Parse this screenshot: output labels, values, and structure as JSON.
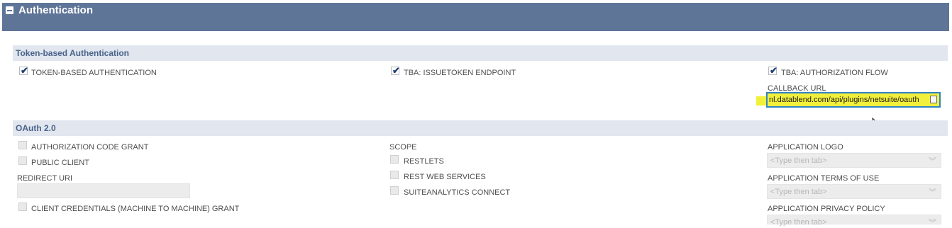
{
  "header": {
    "title": "Authentication"
  },
  "tba_section": {
    "title": "Token-based Authentication",
    "token_based_authentication": {
      "label": "TOKEN-BASED AUTHENTICATION",
      "checked": true
    },
    "issuetoken_endpoint": {
      "label": "TBA: ISSUETOKEN ENDPOINT",
      "checked": true
    },
    "authorization_flow": {
      "label": "TBA: AUTHORIZATION FLOW",
      "checked": true
    },
    "callback_url": {
      "label": "CALLBACK URL",
      "value": "nl.datablend.com/api/plugins/netsuite/oauth"
    }
  },
  "oauth_section": {
    "title": "OAuth 2.0",
    "authorization_code_grant": {
      "label": "AUTHORIZATION CODE GRANT",
      "checked": false
    },
    "public_client": {
      "label": "PUBLIC CLIENT",
      "checked": false
    },
    "redirect_uri": {
      "label": "REDIRECT URI",
      "value": ""
    },
    "client_credentials_grant": {
      "label": "CLIENT CREDENTIALS (MACHINE TO MACHINE) GRANT",
      "checked": false
    },
    "scope": {
      "label": "SCOPE",
      "restlets": "RESTLETS",
      "rest_web_services": "REST WEB SERVICES",
      "suiteanalytics_connect": "SUITEANALYTICS CONNECT"
    },
    "application_logo": {
      "label": "APPLICATION LOGO",
      "placeholder": "<Type then tab>"
    },
    "application_terms_of_use": {
      "label": "APPLICATION TERMS OF USE",
      "placeholder": "<Type then tab>"
    },
    "application_privacy_policy": {
      "label": "APPLICATION PRIVACY POLICY",
      "placeholder": "<Type then tab>"
    }
  },
  "colors": {
    "header_bg": "#5f7598",
    "section_bg": "#e1e6ef",
    "section_title": "#4a6389",
    "highlight": "#f2f03b",
    "focus_border": "#2f84c6"
  }
}
